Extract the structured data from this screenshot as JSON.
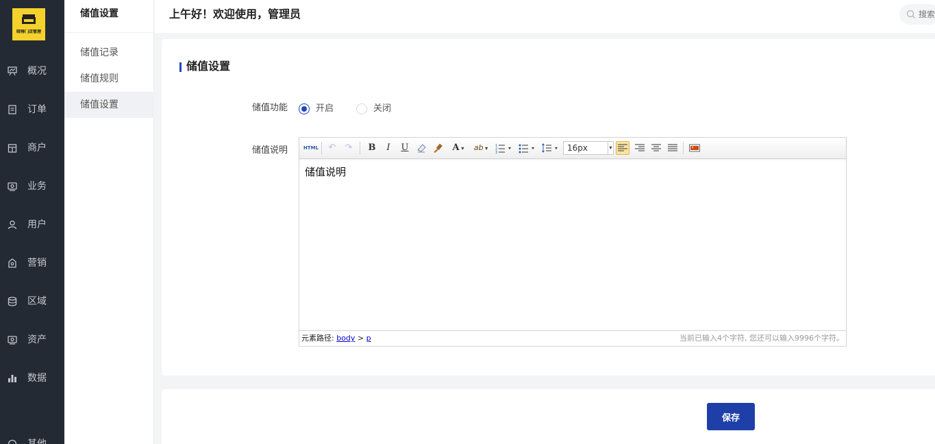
{
  "logo": {
    "text": "晓得门店管理",
    "alt": "store-logo"
  },
  "nav": {
    "items": [
      {
        "label": "概况",
        "icon": "overview-icon"
      },
      {
        "label": "订单",
        "icon": "order-icon"
      },
      {
        "label": "商户",
        "icon": "merchant-icon"
      },
      {
        "label": "业务",
        "icon": "business-icon"
      },
      {
        "label": "用户",
        "icon": "user-icon"
      },
      {
        "label": "营销",
        "icon": "marketing-icon"
      },
      {
        "label": "区域",
        "icon": "region-icon"
      },
      {
        "label": "资产",
        "icon": "asset-icon"
      },
      {
        "label": "数据",
        "icon": "data-icon"
      },
      {
        "label": "其他",
        "icon": "other-icon"
      }
    ]
  },
  "submenu": {
    "title": "储值设置",
    "items": [
      {
        "label": "储值记录",
        "active": false
      },
      {
        "label": "储值规则",
        "active": false
      },
      {
        "label": "储值设置",
        "active": true
      }
    ]
  },
  "header": {
    "greeting": "上午好！欢迎使用，管理员",
    "search_placeholder": "搜索"
  },
  "main": {
    "section_title": "储值设置",
    "feature_label": "储值功能",
    "radio_on": "开启",
    "radio_off": "关闭",
    "radio_selected": "开启",
    "desc_label": "储值说明",
    "editor": {
      "toolbar": {
        "html": "HTML",
        "bold": "B",
        "italic": "I",
        "underline": "U",
        "font_color": "A",
        "highlight": "ab",
        "font_size": "16px"
      },
      "content": "储值说明",
      "path_label": "元素路径:",
      "path_body": "body",
      "path_sep": ">",
      "path_p": "p",
      "word_count": "当前已输入4个字符, 您还可以输入9996个字符。"
    },
    "save_label": "保存"
  },
  "colors": {
    "accent": "#1e47b8",
    "sidebar_bg": "#242a33",
    "logo_bg": "#f4d22b",
    "save_button": "#1f3fa8"
  }
}
